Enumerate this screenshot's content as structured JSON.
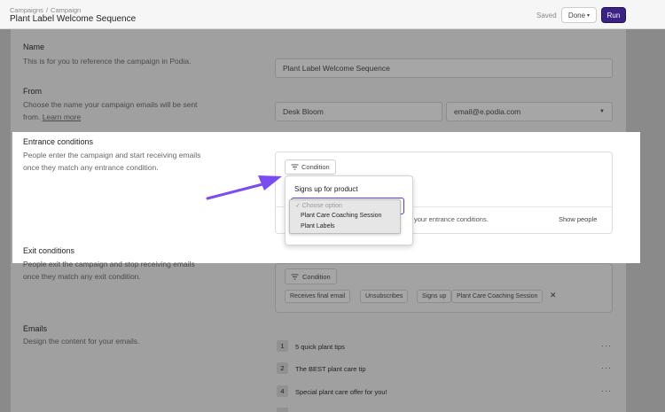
{
  "header": {
    "breadcrumb_root": "Campaigns",
    "breadcrumb_sep": "/",
    "breadcrumb_current": "Campaign",
    "title": "Plant Label Welcome Sequence",
    "saved": "Saved",
    "done": "Done",
    "run": "Run"
  },
  "name_section": {
    "label": "Name",
    "desc": "This is for you to reference the campaign in Podia.",
    "value": "Plant Label Welcome Sequence"
  },
  "from_section": {
    "label": "From",
    "desc1": "Choose the name your campaign emails will be sent",
    "desc2": "from.",
    "learn_more": "Learn more",
    "sender_name": "Desk Bloom",
    "sender_email": "email@e.podia.com"
  },
  "entrance": {
    "label": "Entrance conditions",
    "desc1": "People enter the campaign and start receiving emails",
    "desc2": "once they match any entrance condition.",
    "condition_button": "Condition",
    "hint": "your entrance conditions.",
    "show_people": "Show people"
  },
  "popup": {
    "title": "Signs up for product",
    "options": [
      "✓ Choose option",
      "Plant Care Coaching Session",
      "Plant Labels"
    ]
  },
  "exit": {
    "label": "Exit conditions",
    "desc1": "People exit the campaign and stop receiving emails",
    "desc2": "once they match any exit condition.",
    "condition_button": "Condition",
    "chips": [
      "Receives final email",
      "Unsubscribes",
      "Signs up",
      "Plant Care Coaching Session"
    ]
  },
  "emails": {
    "label": "Emails",
    "desc": "Design the content for your emails.",
    "items": [
      {
        "num": "1",
        "title": "5 quick plant tips"
      },
      {
        "num": "2",
        "title": "The BEST plant care tip"
      },
      {
        "num": "4",
        "title": "Special plant care offer for you!"
      }
    ],
    "more": "···"
  },
  "colors": {
    "accent": "#3b2386",
    "arrow": "#7b4cf0"
  }
}
